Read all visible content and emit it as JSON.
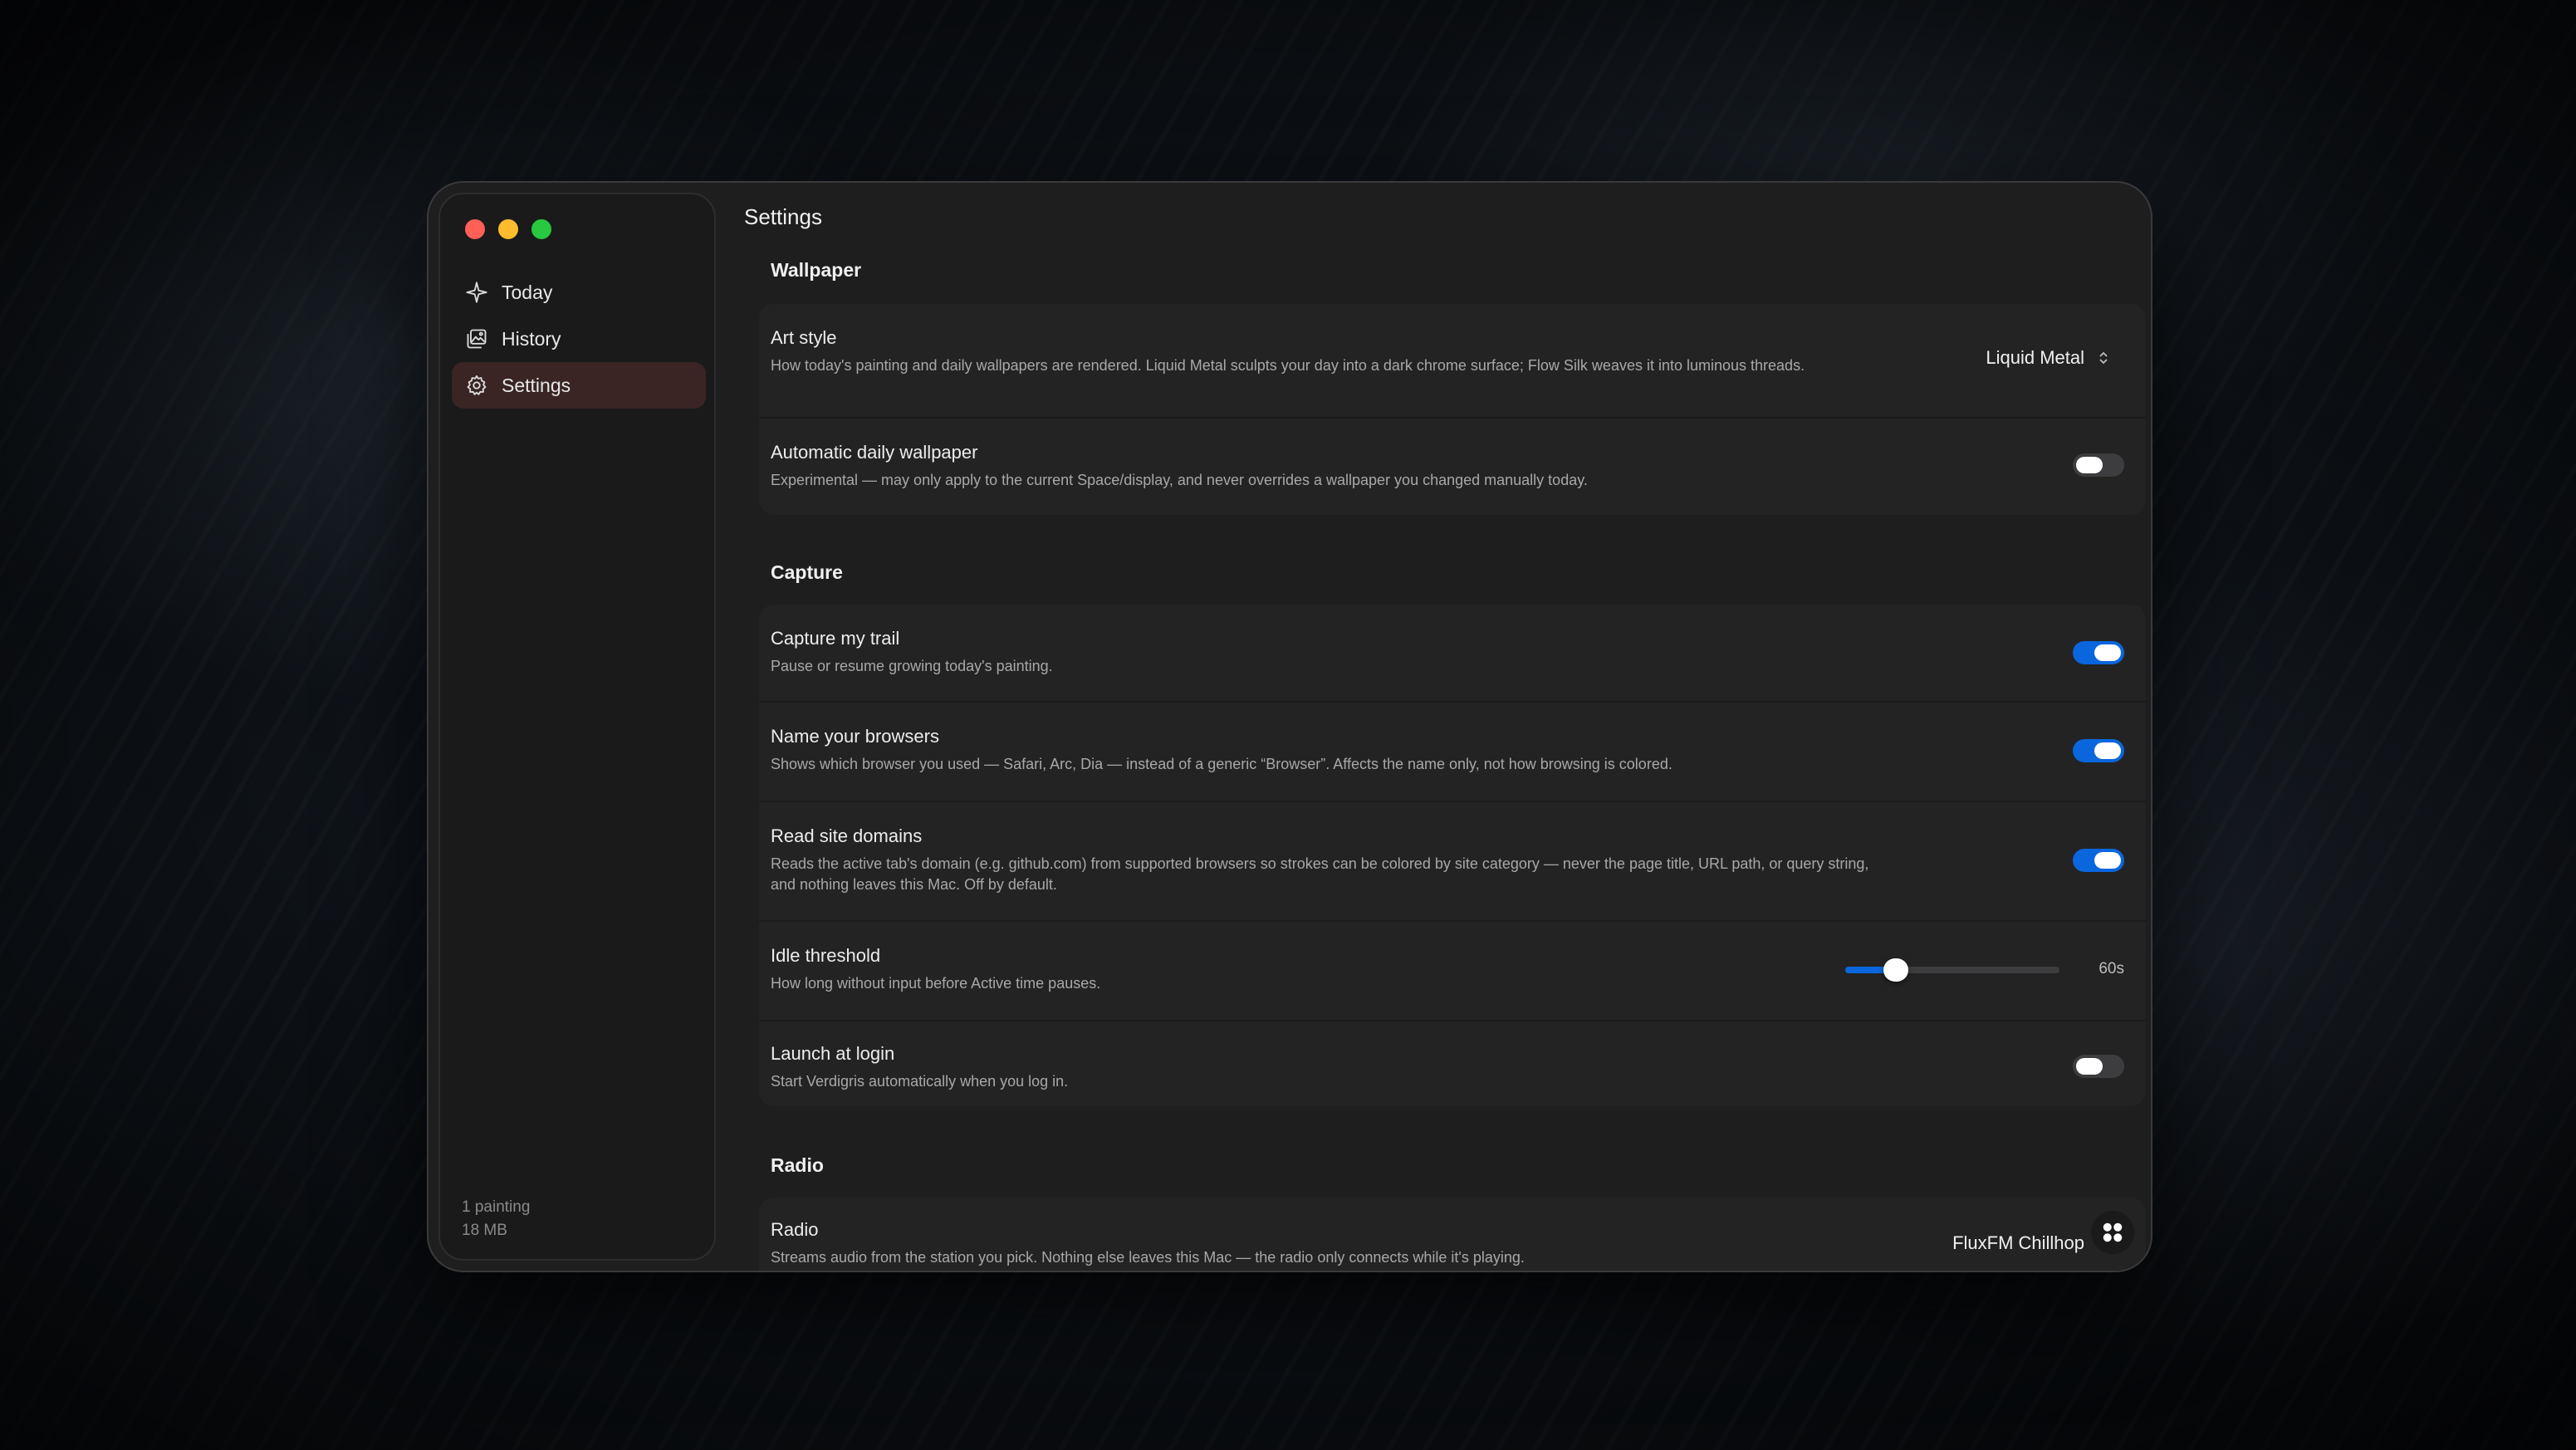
{
  "window": {
    "title": "Settings"
  },
  "sidebar": {
    "items": [
      {
        "label": "Today",
        "icon": "sparkle-icon"
      },
      {
        "label": "History",
        "icon": "photo-stack-icon"
      },
      {
        "label": "Settings",
        "icon": "gear-icon"
      }
    ],
    "active": "Settings",
    "footer": {
      "count": "1 painting",
      "size": "18 MB"
    }
  },
  "sections": {
    "wallpaper": {
      "title": "Wallpaper",
      "art_style": {
        "title": "Art style",
        "desc": "How today's painting and daily wallpapers are rendered. Liquid Metal sculpts your day into a dark chrome surface; Flow Silk weaves it into luminous threads.",
        "value": "Liquid Metal"
      },
      "auto_wallpaper": {
        "title": "Automatic daily wallpaper",
        "desc": "Experimental — may only apply to the current Space/display, and never overrides a wallpaper you changed manually today.",
        "enabled": false
      }
    },
    "capture": {
      "title": "Capture",
      "capture_trail": {
        "title": "Capture my trail",
        "desc": "Pause or resume growing today's painting.",
        "enabled": true
      },
      "name_browsers": {
        "title": "Name your browsers",
        "desc": "Shows which browser you used — Safari, Arc, Dia — instead of a generic “Browser”. Affects the name only, not how browsing is colored.",
        "enabled": true
      },
      "read_domains": {
        "title": "Read site domains",
        "desc_line1": "Reads the active tab's domain (e.g. github.com) from supported browsers so strokes can be colored by site category — never the page title, URL path, or query string,",
        "desc_line2": "and nothing leaves this Mac. Off by default.",
        "enabled": true
      },
      "idle_threshold": {
        "title": "Idle threshold",
        "desc": "How long without input before Active time pauses.",
        "value_label": "60s",
        "level": 0.2
      },
      "launch_login": {
        "title": "Launch at login",
        "desc": "Start Verdigris automatically when you log in.",
        "enabled": false
      }
    },
    "radio": {
      "title": "Radio",
      "radio": {
        "title": "Radio",
        "desc": "Streams audio from the station you pick. Nothing else leaves this Mac — the radio only connects while it's playing.",
        "value": "FluxFM Chillhop"
      }
    }
  },
  "colors": {
    "accent": "#0a66dd",
    "active_nav": "#3a2424",
    "window_bg": "#1e1e1f",
    "card_bg": "#232323"
  }
}
